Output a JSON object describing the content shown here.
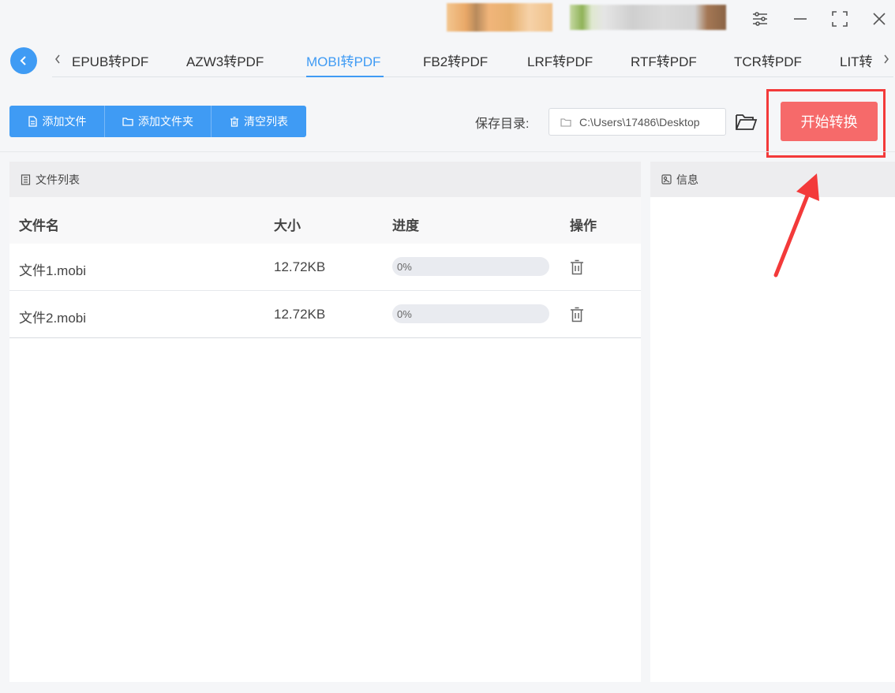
{
  "tabs": {
    "items": [
      {
        "label": "EPUB转PDF"
      },
      {
        "label": "AZW3转PDF"
      },
      {
        "label": "MOBI转PDF"
      },
      {
        "label": "FB2转PDF"
      },
      {
        "label": "LRF转PDF"
      },
      {
        "label": "RTF转PDF"
      },
      {
        "label": "TCR转PDF"
      },
      {
        "label": "LIT转"
      }
    ],
    "active_index": 2
  },
  "toolbar": {
    "add_file": "添加文件",
    "add_folder": "添加文件夹",
    "clear_list": "清空列表",
    "save_dir_label": "保存目录:",
    "save_dir_value": "C:\\Users\\17486\\Desktop",
    "start_button": "开始转换"
  },
  "file_panel": {
    "title": "文件列表",
    "columns": {
      "name": "文件名",
      "size": "大小",
      "progress": "进度",
      "action": "操作"
    },
    "rows": [
      {
        "name": "文件1.mobi",
        "size": "12.72KB",
        "progress_text": "0%",
        "progress": 0
      },
      {
        "name": "文件2.mobi",
        "size": "12.72KB",
        "progress_text": "0%",
        "progress": 0
      }
    ]
  },
  "info_panel": {
    "title": "信息"
  },
  "colors": {
    "accent": "#3f9bf4",
    "start_button": "#f66a6a",
    "highlight": "#f33a3a"
  }
}
